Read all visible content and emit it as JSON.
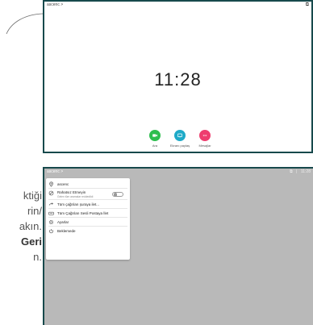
{
  "colors": {
    "frame": "#17494c",
    "green": "#2dbe4e",
    "cyan": "#1faac8",
    "pink": "#ee3d6e",
    "overlay": "#b9b9b9"
  },
  "top_screen": {
    "device_name": "ascenc >",
    "clock": "11:28",
    "top_right_icon": "screen-share-icon",
    "actions": [
      {
        "label": "Ara",
        "icon": "phone-icon",
        "color": "#2dbe4e"
      },
      {
        "label": "Ekranı paylaş",
        "icon": "share-icon",
        "color": "#1faac8"
      },
      {
        "label": "Mesajlar",
        "icon": "message-icon",
        "color": "#ee3d6e"
      }
    ]
  },
  "left_text": {
    "line1": "ktiği",
    "line2": "rin/",
    "line3": "akın.",
    "line4": "Geri",
    "line5": "n."
  },
  "bottom_screen": {
    "device_name": "ascenc >",
    "clock": "11:28",
    "separator": "|",
    "menu": {
      "device": "ascenc",
      "dnd_title": "Rahatsız Etmeyin",
      "dnd_sub": "Gelen tüm aramalar reddedildi",
      "forward_all": "Tüm çağrıları şuraya ilet...",
      "forward_voicemail": "Tüm Çağrıları Sesli Postaya İlet",
      "settings": "Ayarlar",
      "standby": "Beklemede"
    }
  }
}
